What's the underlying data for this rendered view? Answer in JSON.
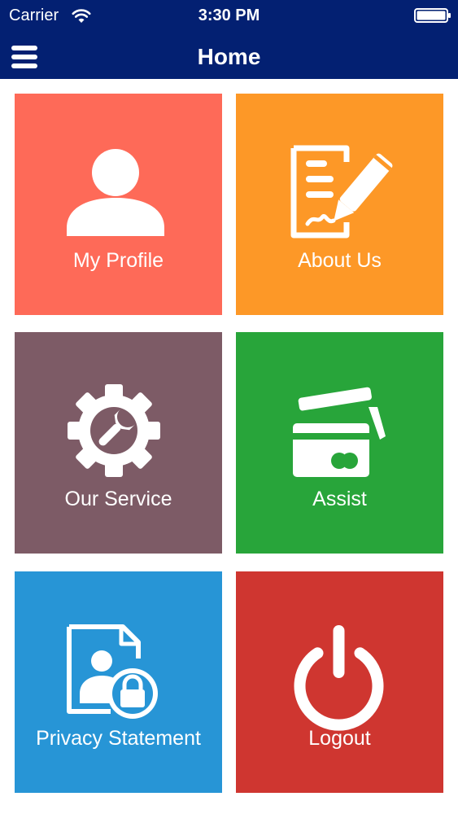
{
  "status_bar": {
    "carrier": "Carrier",
    "time": "3:30 PM",
    "icons": [
      "wifi-icon",
      "battery-icon"
    ]
  },
  "nav": {
    "title": "Home",
    "menu_icon": "hamburger-menu-icon"
  },
  "colors": {
    "nav_background": "#032072",
    "text": "#ffffff"
  },
  "tiles": [
    {
      "label": "My Profile",
      "icon": "user-profile-icon",
      "color": "#FE6A58"
    },
    {
      "label": "About Us",
      "icon": "document-edit-icon",
      "color": "#FD9827"
    },
    {
      "label": "Our Service",
      "icon": "settings-wrench-icon",
      "color": "#7D5B66"
    },
    {
      "label": "Assist",
      "icon": "credit-card-icon",
      "color": "#28A53A"
    },
    {
      "label": "Privacy Statement",
      "icon": "privacy-document-lock-icon",
      "color": "#2795D6"
    },
    {
      "label": "Logout",
      "icon": "power-icon",
      "color": "#CF3630"
    }
  ]
}
